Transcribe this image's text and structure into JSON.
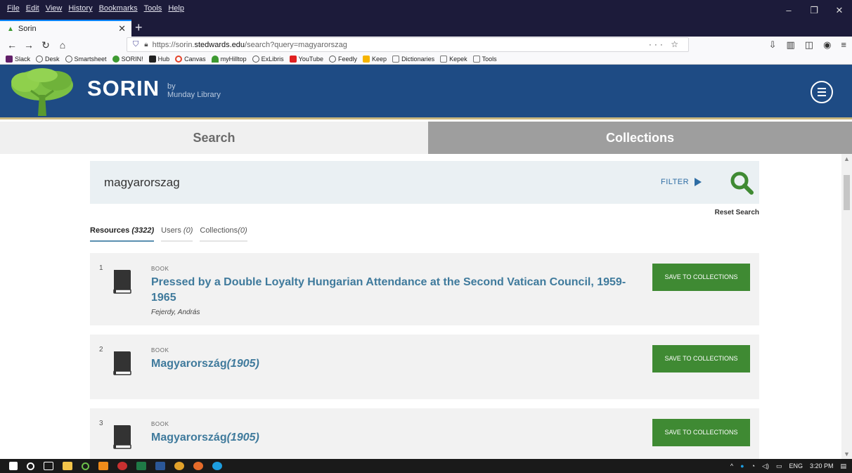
{
  "browser": {
    "menus": [
      "File",
      "Edit",
      "View",
      "History",
      "Bookmarks",
      "Tools",
      "Help"
    ],
    "tab_title": "Sorin",
    "url_prefix": "https://sorin.",
    "url_host": "stedwards.edu",
    "url_path": "/search?query=magyarorszag",
    "bookmarks": [
      {
        "label": "Slack",
        "color": "#611f69"
      },
      {
        "label": "Desk",
        "color": "#555555"
      },
      {
        "label": "Smartsheet",
        "color": "#555555"
      },
      {
        "label": "SORIN!",
        "color": "#3e9a32"
      },
      {
        "label": "Hub",
        "color": "#222222"
      },
      {
        "label": "Canvas",
        "color": "#e4432a"
      },
      {
        "label": "myHilltop",
        "color": "#3e9a32"
      },
      {
        "label": "ExLibris",
        "color": "#555555"
      },
      {
        "label": "YouTube",
        "color": "#e02020"
      },
      {
        "label": "Feedly",
        "color": "#555555"
      },
      {
        "label": "Keep",
        "color": "#f6b400"
      },
      {
        "label": "Dictionaries",
        "color": "#777777"
      },
      {
        "label": "Kepek",
        "color": "#777777"
      },
      {
        "label": "Tools",
        "color": "#777777"
      }
    ]
  },
  "site": {
    "logo": "SORIN",
    "by_line1": "by",
    "by_line2": "Munday Library"
  },
  "main_tabs": {
    "search": "Search",
    "collections": "Collections"
  },
  "search": {
    "query": "magyarorszag",
    "filter_label": "FILTER",
    "reset_label": "Reset Search"
  },
  "result_tabs": {
    "resources_label": "Resources",
    "resources_count": "(3322)",
    "users_label": "Users",
    "users_count": "(0)",
    "collections_label": "Collections",
    "collections_count": "(0)"
  },
  "results": [
    {
      "num": "1",
      "type": "BOOK",
      "title": "Pressed by a Double Loyalty Hungarian Attendance at the Second Vatican Council, 1959-1965",
      "year": "",
      "author": "Fejerdy, András",
      "save": "SAVE TO COLLECTIONS"
    },
    {
      "num": "2",
      "type": "BOOK",
      "title": "Magyarország",
      "year": "(1905)",
      "author": "",
      "save": "SAVE TO COLLECTIONS"
    },
    {
      "num": "3",
      "type": "BOOK",
      "title": "Magyarország",
      "year": "(1905)",
      "author": "",
      "save": "SAVE TO COLLECTIONS"
    }
  ],
  "taskbar": {
    "lang": "ENG",
    "time": "3:20 PM"
  },
  "colors": {
    "header_blue": "#1e4b84",
    "accent_green": "#3f8a33",
    "link_blue": "#3f7a9c"
  }
}
